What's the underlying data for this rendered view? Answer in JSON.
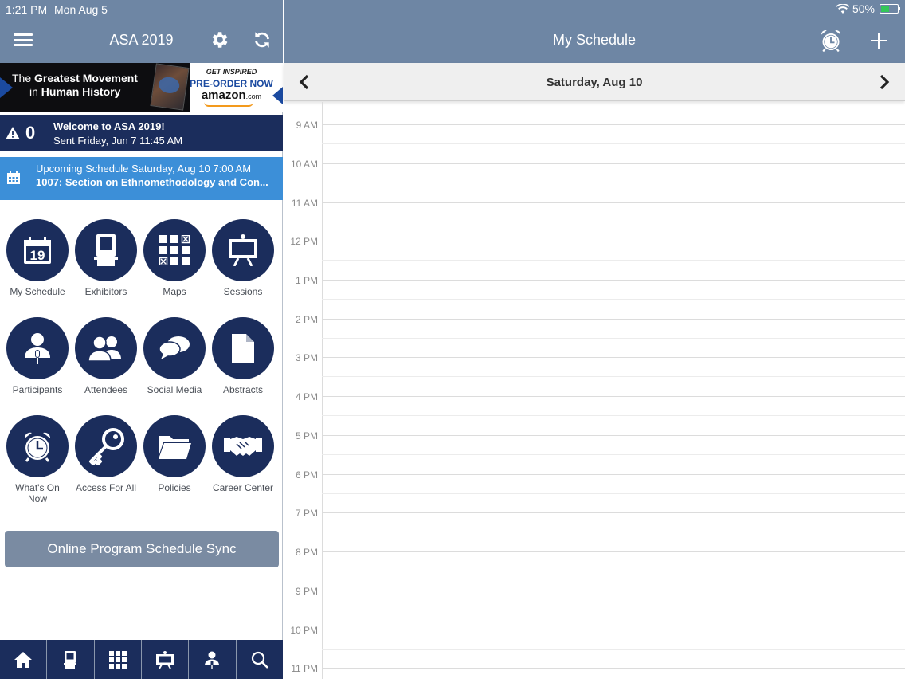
{
  "status": {
    "time": "1:21 PM",
    "date": "Mon Aug 5",
    "battery": "50%"
  },
  "left_header": {
    "title": "ASA 2019"
  },
  "ad": {
    "line1_a": "The ",
    "line1_b": "Greatest Movement",
    "line2_a": "in ",
    "line2_b": "Human History",
    "get_inspired": "GET INSPIRED",
    "preorder": "PRE-ORDER NOW",
    "amazon": "amazon",
    "amazon_suffix": ".com"
  },
  "alert": {
    "count": "0",
    "title": "Welcome to ASA 2019!",
    "sub": "Sent Friday, Jun 7 11:45 AM"
  },
  "upcoming": {
    "line1": "Upcoming Schedule Saturday, Aug 10 7:00 AM",
    "line2": "1007: Section on Ethnomethodology and Con..."
  },
  "tiles": [
    {
      "label": "My Schedule",
      "icon": "calendar-icon",
      "day": "19"
    },
    {
      "label": "Exhibitors",
      "icon": "booth-icon"
    },
    {
      "label": "Maps",
      "icon": "map-grid-icon"
    },
    {
      "label": "Sessions",
      "icon": "easel-icon"
    },
    {
      "label": "Participants",
      "icon": "speaker-icon"
    },
    {
      "label": "Attendees",
      "icon": "people-icon"
    },
    {
      "label": "Social Media",
      "icon": "chat-bubbles-icon"
    },
    {
      "label": "Abstracts",
      "icon": "document-icon"
    },
    {
      "label": "What's On Now",
      "icon": "alarm-clock-icon"
    },
    {
      "label": "Access For All",
      "icon": "key-icon"
    },
    {
      "label": "Policies",
      "icon": "folder-icon"
    },
    {
      "label": "Career Center",
      "icon": "handshake-icon"
    }
  ],
  "sync_label": "Online Program Schedule Sync",
  "tabbar": [
    "home-icon",
    "booth-icon",
    "map-grid-icon",
    "easel-icon",
    "speaker-icon",
    "search-icon"
  ],
  "right_header": {
    "title": "My Schedule"
  },
  "datebar": {
    "date": "Saturday, Aug 10"
  },
  "hours": [
    "9 AM",
    "10 AM",
    "11 AM",
    "12 PM",
    "1 PM",
    "2 PM",
    "3 PM",
    "4 PM",
    "5 PM",
    "6 PM",
    "7 PM",
    "8 PM",
    "9 PM",
    "10 PM",
    "11 PM"
  ],
  "colors": {
    "header": "#6e86a4",
    "navy": "#1b2d5c",
    "upcoming": "#3c8fd8",
    "sync": "#7a8ba2"
  }
}
